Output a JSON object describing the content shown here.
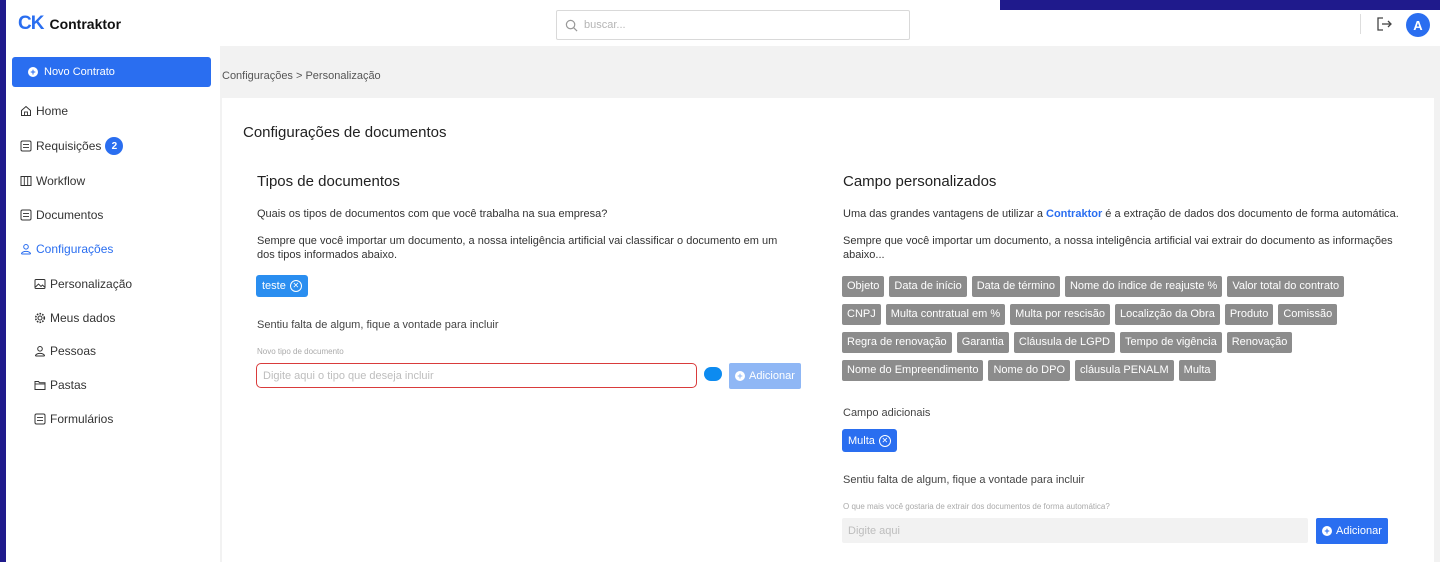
{
  "brand": {
    "mark_left": "C",
    "mark_right": "K",
    "name": "Contraktor"
  },
  "search": {
    "placeholder": "buscar..."
  },
  "user": {
    "avatar_letter": "A"
  },
  "sidebar": {
    "new_contract": "Novo Contrato",
    "items": [
      {
        "label": "Home",
        "icon": "home-icon"
      },
      {
        "label": "Requisições",
        "icon": "list-icon",
        "badge": "2"
      },
      {
        "label": "Workflow",
        "icon": "columns-icon"
      },
      {
        "label": "Documentos",
        "icon": "document-icon"
      },
      {
        "label": "Configurações",
        "icon": "people-icon",
        "active": true
      },
      {
        "label": "Personalização",
        "icon": "image-icon"
      },
      {
        "label": "Meus dados",
        "icon": "gear-icon"
      },
      {
        "label": "Pessoas",
        "icon": "people-icon"
      },
      {
        "label": "Pastas",
        "icon": "folder-icon"
      },
      {
        "label": "Formulários",
        "icon": "form-icon"
      }
    ]
  },
  "breadcrumb": "Configurações > Personalização",
  "page_title": "Configurações de documentos",
  "doc_types": {
    "title": "Tipos de documentos",
    "question": "Quais os tipos de documentos com que você trabalha na sua empresa?",
    "description": "Sempre que você importar um documento, a nossa inteligência artificial vai classificar o documento em um dos tipos informados abaixo.",
    "chips": [
      "teste"
    ],
    "missing_label": "Sentiu falta de algum, fique a vontade para incluir",
    "input_label": "Novo tipo de documento",
    "input_placeholder": "Digite aqui o tipo que deseja incluir",
    "add_button": "Adicionar"
  },
  "custom_fields": {
    "title": "Campo personalizados",
    "intro_before": "Uma das grandes vantagens de utilizar a ",
    "intro_link": "Contraktor",
    "intro_after": " é a extração de dados dos documento de forma automática.",
    "description": "Sempre que você importar um documento, a nossa inteligência artificial vai extrair do documento as informações abaixo...",
    "tag_rows": [
      [
        "Objeto",
        "Data de início",
        "Data de término",
        "Nome do índice de reajuste %",
        "Valor total do contrato"
      ],
      [
        "CNPJ",
        "Multa contratual em %",
        "Multa por rescisão",
        "Localizção da Obra",
        "Produto",
        "Comissão"
      ],
      [
        "Regra de renovação",
        "Garantia",
        "Cláusula de LGPD",
        "Tempo de vigência",
        "Renovação"
      ],
      [
        "Nome do Empreendimento",
        "Nome do DPO",
        "cláusula PENALM",
        "Multa"
      ]
    ],
    "additional_label": "Campo adicionais",
    "additional_chips": [
      "Multa"
    ],
    "missing_label": "Sentiu falta de algum, fique a vontade para incluir",
    "input_label": "O que mais você gostaria de extrair dos documentos de forma automática?",
    "input_placeholder": "Digite aqui",
    "add_button": "Adicionar"
  },
  "colors": {
    "primary": "#2a6ef0",
    "navy": "#1f1a8c",
    "tag_grey": "#8c8c8c",
    "error_red": "#d93b3b"
  }
}
